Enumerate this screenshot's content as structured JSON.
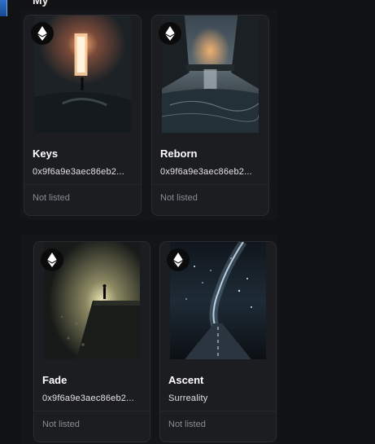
{
  "header": {
    "section_title_fragment": "My"
  },
  "cards": [
    {
      "title": "Keys",
      "subtitle": "0x9f6a9e3aec86eb2...",
      "status": "Not listed",
      "chain_icon": "ethereum-icon"
    },
    {
      "title": "Reborn",
      "subtitle": "0x9f6a9e3aec86eb2...",
      "status": "Not listed",
      "chain_icon": "ethereum-icon"
    },
    {
      "title": "Fade",
      "subtitle": "0x9f6a9e3aec86eb2...",
      "status": "Not listed",
      "chain_icon": "ethereum-icon"
    },
    {
      "title": "Ascent",
      "subtitle": "Surreality",
      "status": "Not listed",
      "chain_icon": "ethereum-icon"
    }
  ],
  "colors": {
    "background": "#111214",
    "card_background": "#1c1d21",
    "card_border": "#2a2b30",
    "muted_text": "#8a8c92"
  }
}
